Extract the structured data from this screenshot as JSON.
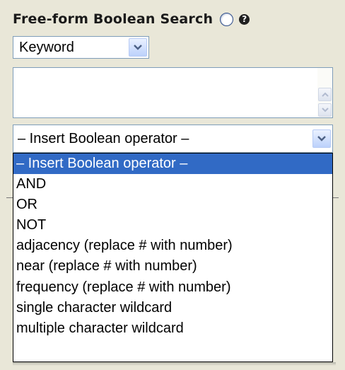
{
  "header": {
    "title": "Free-form Boolean Search",
    "radio_icon": "radio-button-icon",
    "help_icon": "help-icon",
    "help_glyph": "?"
  },
  "field_select": {
    "value": "Keyword"
  },
  "search_textarea": {
    "value": ""
  },
  "operator_select": {
    "value": "– Insert Boolean operator –",
    "options": [
      "– Insert Boolean operator –",
      "AND",
      "OR",
      "NOT",
      "adjacency (replace # with number)",
      "near (replace # with number)",
      "frequency (replace # with number)",
      "single character wildcard",
      "multiple character wildcard"
    ],
    "highlighted_index": 0
  },
  "colors": {
    "highlight": "#316ac5",
    "panel_bg": "#e9e7d8",
    "input_border": "#7f9db9",
    "arrow": "#4d6185"
  }
}
